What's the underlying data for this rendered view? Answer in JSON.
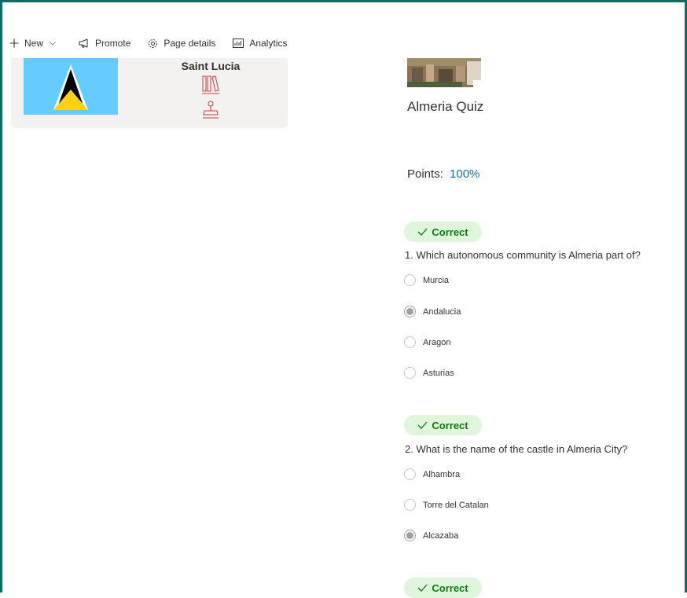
{
  "toolbar": {
    "new_label": "New",
    "promote_label": "Promote",
    "page_details_label": "Page details",
    "analytics_label": "Analytics"
  },
  "card": {
    "title": "Saint Lucia",
    "flag_colors": {
      "background": "#66ccff",
      "white": "#ffffff",
      "black": "#000000",
      "yellow": "#fcd116"
    },
    "icons": [
      "books-icon",
      "stamp-icon"
    ]
  },
  "quiz": {
    "title": "Almeria Quiz",
    "points_label": "Points:",
    "points_value": "100%",
    "questions": [
      {
        "badge": "Correct",
        "text": "1. Which autonomous community is Almeria part of?",
        "options": [
          {
            "label": "Murcia",
            "selected": false
          },
          {
            "label": "Andalucia",
            "selected": true
          },
          {
            "label": "Aragon",
            "selected": false
          },
          {
            "label": "Asturias",
            "selected": false
          }
        ]
      },
      {
        "badge": "Correct",
        "text": "2. What is the name of the castle in Almeria City?",
        "options": [
          {
            "label": "Alhambra",
            "selected": false
          },
          {
            "label": "Torre del Catalan",
            "selected": false
          },
          {
            "label": "Alcazaba",
            "selected": true
          }
        ]
      },
      {
        "badge": "Correct"
      }
    ]
  },
  "colors": {
    "frame": "#0d6b63",
    "correct_bg": "#dff6dd",
    "correct_text": "#107c10",
    "points_value": "#0f6cbd",
    "icon_red": "#d13438"
  }
}
